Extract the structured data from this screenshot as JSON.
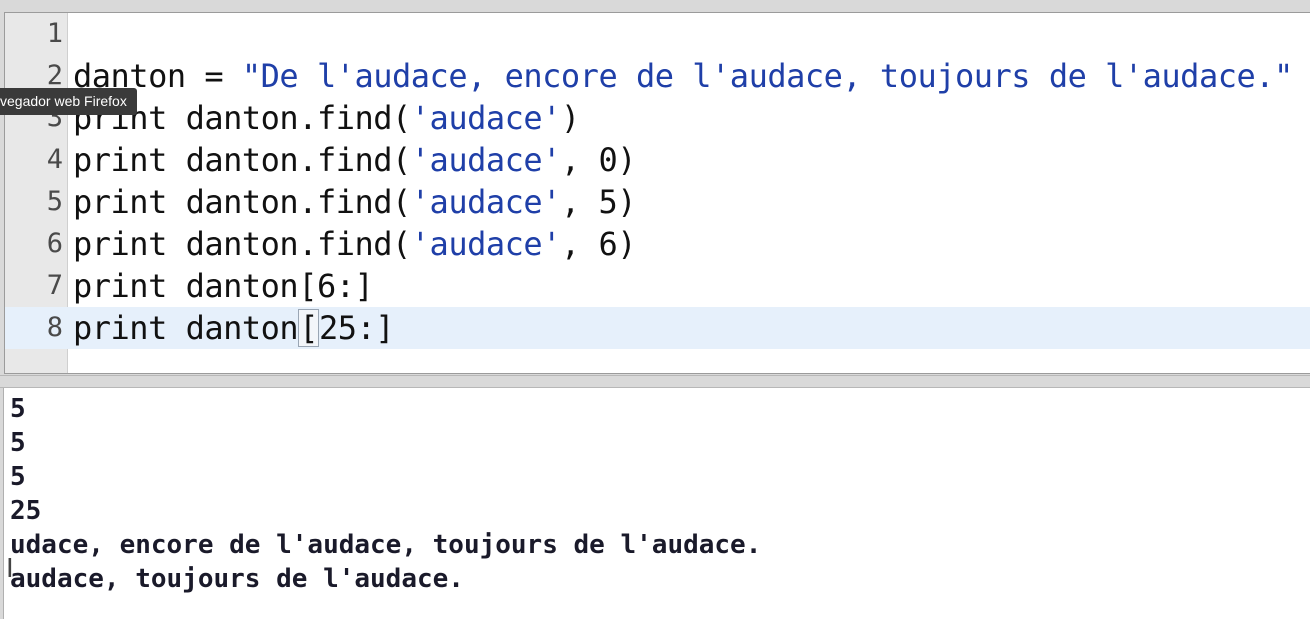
{
  "tooltip": {
    "text": "vegador web Firefox"
  },
  "editor": {
    "lines": [
      {
        "num": "1",
        "segments": []
      },
      {
        "num": "2",
        "segments": [
          {
            "t": "danton = ",
            "c": "kw"
          },
          {
            "t": "\"De l'audace, encore de l'audace, toujours de l'audace.\"",
            "c": "str"
          }
        ]
      },
      {
        "num": "3",
        "segments": [
          {
            "t": "print danton.find(",
            "c": "kw"
          },
          {
            "t": "'audace'",
            "c": "str"
          },
          {
            "t": ")",
            "c": "kw"
          }
        ]
      },
      {
        "num": "4",
        "segments": [
          {
            "t": "print danton.find(",
            "c": "kw"
          },
          {
            "t": "'audace'",
            "c": "str"
          },
          {
            "t": ", 0)",
            "c": "kw"
          }
        ]
      },
      {
        "num": "5",
        "segments": [
          {
            "t": "print danton.find(",
            "c": "kw"
          },
          {
            "t": "'audace'",
            "c": "str"
          },
          {
            "t": ", 5)",
            "c": "kw"
          }
        ]
      },
      {
        "num": "6",
        "segments": [
          {
            "t": "print danton.find(",
            "c": "kw"
          },
          {
            "t": "'audace'",
            "c": "str"
          },
          {
            "t": ", 6)",
            "c": "kw"
          }
        ]
      },
      {
        "num": "7",
        "segments": [
          {
            "t": "print danton[6:]",
            "c": "kw"
          }
        ]
      },
      {
        "num": "8",
        "segments": [
          {
            "t": "print danton",
            "c": "kw"
          },
          {
            "t": "[",
            "c": "bracket"
          },
          {
            "t": "25:]",
            "c": "kw"
          }
        ]
      }
    ],
    "current_line": 8
  },
  "output": {
    "lines": [
      "5",
      "5",
      "5",
      "25",
      "udace, encore de l'audace, toujours de l'audace.",
      "audace, toujours de l'audace."
    ]
  }
}
